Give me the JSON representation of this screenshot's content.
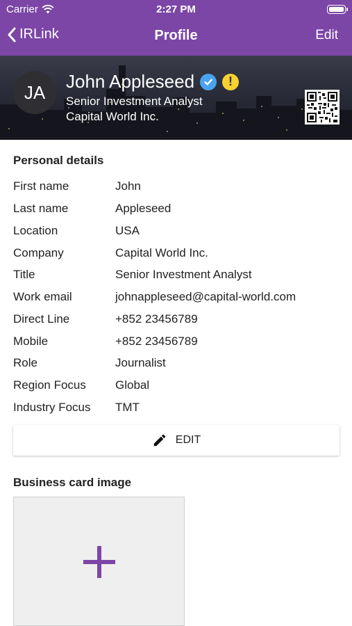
{
  "status_bar": {
    "carrier": "Carrier",
    "time": "2:27 PM"
  },
  "nav": {
    "back_label": "IRLink",
    "title": "Profile",
    "edit_label": "Edit"
  },
  "profile": {
    "initials": "JA",
    "name": "John Appleseed",
    "job_title": "Senior Investment Analyst",
    "company": "Capital World Inc.",
    "warning_badge": "!"
  },
  "personal_details": {
    "heading": "Personal details",
    "rows": [
      {
        "label": "First name",
        "value": "John"
      },
      {
        "label": "Last name",
        "value": "Appleseed"
      },
      {
        "label": "Location",
        "value": "USA"
      },
      {
        "label": "Company",
        "value": "Capital World Inc."
      },
      {
        "label": "Title",
        "value": "Senior Investment Analyst"
      },
      {
        "label": "Work email",
        "value": "johnappleseed@capital-world.com"
      },
      {
        "label": "Direct Line",
        "value": "+852 23456789"
      },
      {
        "label": "Mobile",
        "value": "+852 23456789"
      },
      {
        "label": "Role",
        "value": "Journalist"
      },
      {
        "label": "Region Focus",
        "value": "Global"
      },
      {
        "label": "Industry Focus",
        "value": "TMT"
      }
    ],
    "edit_button_label": "EDIT"
  },
  "business_card": {
    "heading": "Business card image"
  },
  "colors": {
    "accent": "#7b46a6",
    "verified": "#4aa3f0",
    "warning": "#f6d12f"
  },
  "icons": [
    "wifi-icon",
    "battery-icon",
    "chevron-left-icon",
    "verified-check-icon",
    "warning-icon",
    "qr-code-icon",
    "pencil-icon",
    "plus-icon"
  ]
}
